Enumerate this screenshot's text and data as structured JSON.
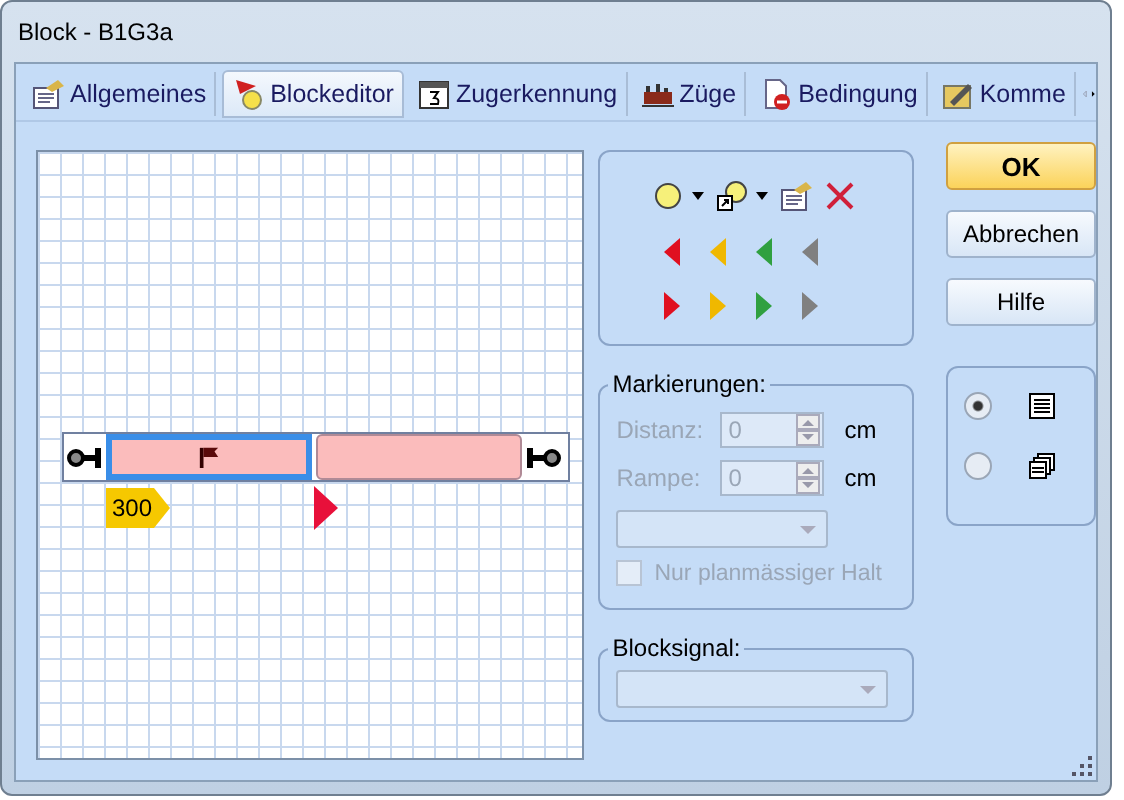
{
  "window": {
    "title": "Block - B1G3a"
  },
  "tabs": [
    {
      "label": "Allgemeines",
      "kind": "general",
      "selected": false
    },
    {
      "label": "Blockeditor",
      "kind": "editor",
      "selected": true
    },
    {
      "label": "Zugerkennung",
      "kind": "calendar",
      "selected": false
    },
    {
      "label": "Züge",
      "kind": "trains",
      "selected": false
    },
    {
      "label": "Bedingung",
      "kind": "condition",
      "selected": false
    },
    {
      "label": "Komme",
      "kind": "comment",
      "selected": false
    }
  ],
  "editor": {
    "blocks": [
      {
        "selected": true,
        "flag": true
      },
      {
        "selected": false,
        "flag": false
      }
    ],
    "marker": "300"
  },
  "signals_left": [
    {
      "color": "#e01020"
    },
    {
      "color": "#f0b800"
    },
    {
      "color": "#30a040"
    },
    {
      "color": "#808080"
    }
  ],
  "signals_right": [
    {
      "color": "#e01020"
    },
    {
      "color": "#f0b800"
    },
    {
      "color": "#30a040"
    },
    {
      "color": "#808080"
    }
  ],
  "markings": {
    "legend": "Markierungen:",
    "disabled": true,
    "fields": [
      {
        "label": "Distanz:",
        "value": "0",
        "unit": "cm"
      },
      {
        "label": "Rampe:",
        "value": "0",
        "unit": "cm"
      }
    ],
    "checkbox": {
      "label": "Nur planmässiger Halt",
      "checked": false
    }
  },
  "block_signal": {
    "legend": "Blocksignal:",
    "disabled": true
  },
  "buttons": [
    {
      "label": "OK",
      "kind": "default"
    },
    {
      "label": "Abbrechen",
      "kind": "normal"
    },
    {
      "label": "Hilfe",
      "kind": "normal"
    }
  ],
  "views": [
    {
      "kind": "list",
      "selected": true
    },
    {
      "kind": "windows",
      "selected": false
    }
  ]
}
